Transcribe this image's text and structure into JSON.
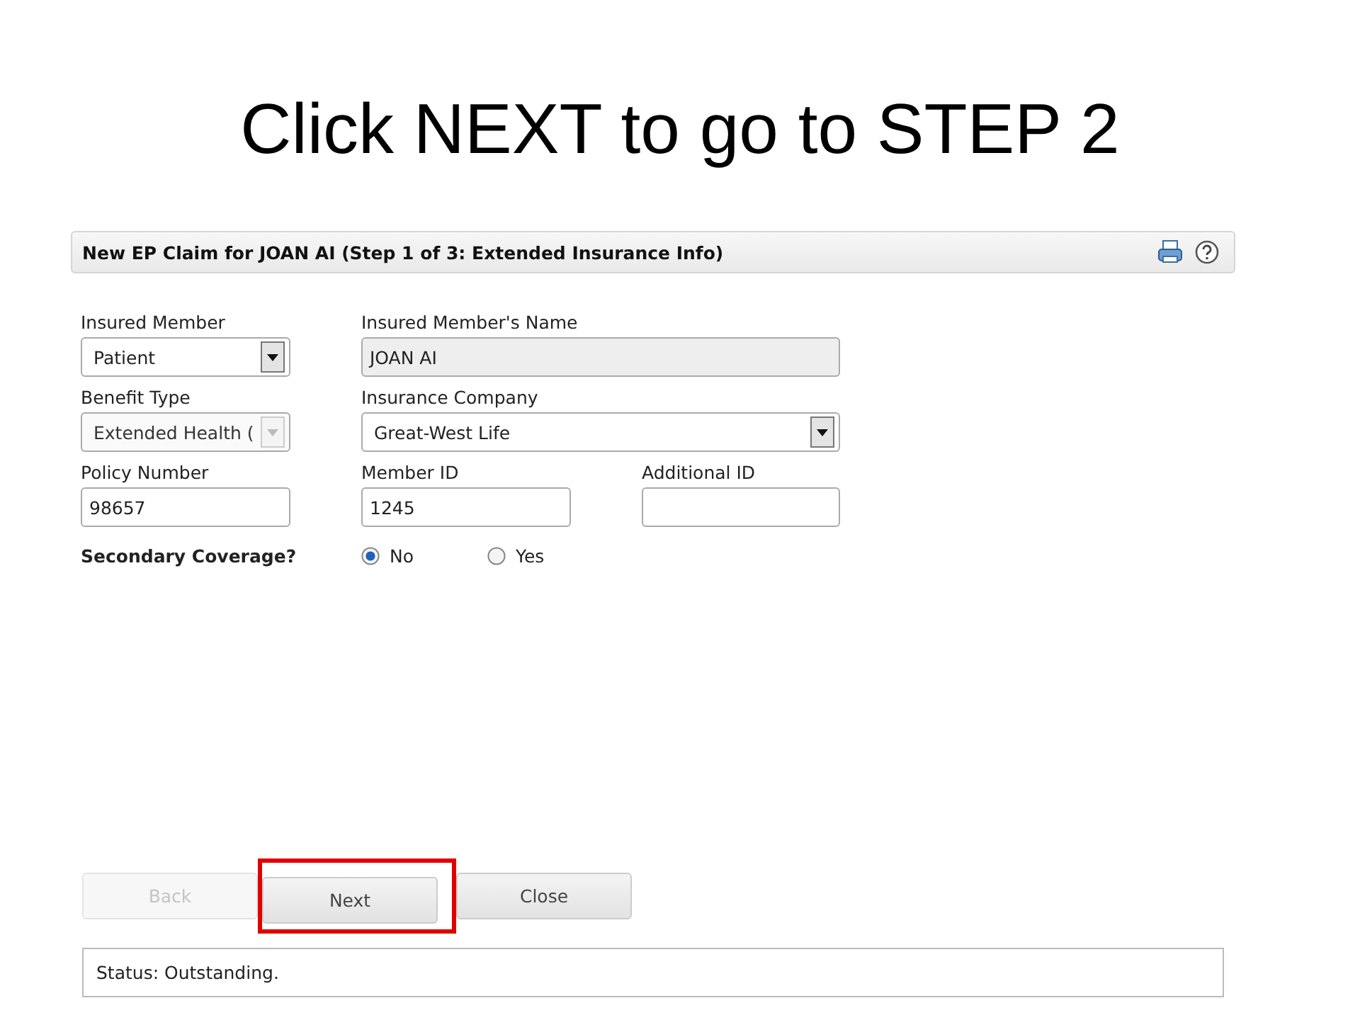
{
  "slide_title": "Click NEXT to go to STEP 2",
  "dialog": {
    "title": "New EP Claim for JOAN AI (Step 1 of 3: Extended Insurance Info)",
    "rows": [
      [
        {
          "label": "Insured Member",
          "value": "Patient",
          "kind": "select",
          "disabled": false
        },
        {
          "label": "Insured Member's Name",
          "value": "JOAN AI",
          "kind": "text",
          "disabled": true
        }
      ],
      [
        {
          "label": "Benefit Type",
          "value": "Extended Health (",
          "kind": "select",
          "disabled": true
        },
        {
          "label": "Insurance Company",
          "value": "Great-West Life",
          "kind": "select",
          "disabled": false
        }
      ],
      [
        {
          "label": "Policy Number",
          "value": "98657",
          "kind": "text",
          "disabled": false
        },
        {
          "label": "Member ID",
          "value": "1245",
          "kind": "text",
          "disabled": false
        },
        {
          "label": "Additional ID",
          "kind": "text",
          "disabled": false
        }
      ]
    ],
    "secondary_coverage": {
      "label": "Secondary Coverage?",
      "options": [
        {
          "label": "No",
          "selected": true
        },
        {
          "label": "Yes",
          "selected": false
        }
      ]
    },
    "buttons": [
      {
        "label": "Back",
        "disabled": true,
        "highlighted": false
      },
      {
        "label": "Next",
        "disabled": false,
        "highlighted": true
      },
      {
        "label": "Close",
        "disabled": false,
        "highlighted": false
      }
    ],
    "status": "Status: Outstanding."
  }
}
